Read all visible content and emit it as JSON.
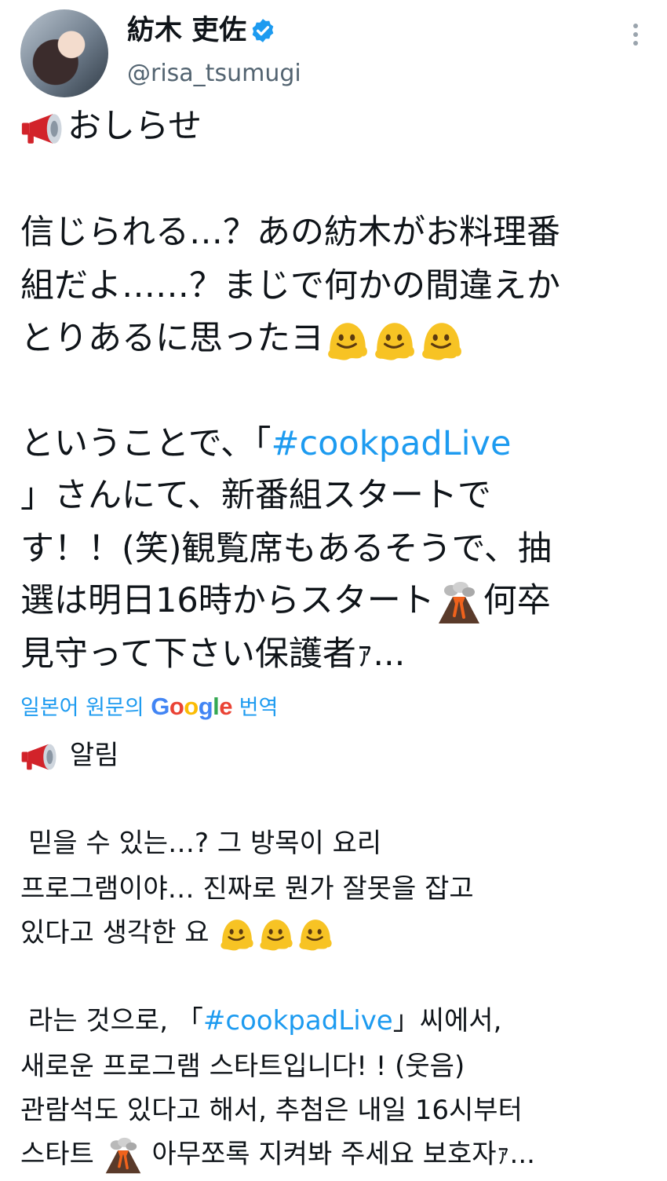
{
  "user": {
    "display_name": "紡木 吏佐",
    "handle": "@risa_tsumugi"
  },
  "icons": {
    "verified": "verified-badge-icon",
    "more": "more-vertical-icon",
    "megaphone": "megaphone-emoji",
    "melting": "melting-face-emoji",
    "volcano": "volcano-emoji"
  },
  "colors": {
    "link": "#1d9bf0",
    "secondary_text": "#536471"
  },
  "original": {
    "heading": "おしらせ",
    "l1": "信じられる…？あの紡木がお料理番",
    "l2": "組だよ……？まじで何かの間違えか",
    "l3": "とりあるに思ったヨ",
    "l4": "ということで、「",
    "l4_hashtag": "#cookpadLive",
    "l5": "」さんにて、新番組スタートで",
    "l6": "す！！(笑)観覧席もあるそうで、抽",
    "l7": "選は明日16時からスタート",
    "l7_after": "何卒",
    "l8": "見守って下さい保護者ｧ..."
  },
  "translation": {
    "label_before": "일본어 원문의",
    "brand": "Google",
    "label_after": "번역",
    "heading": "알림",
    "l1": "믿을 수 있는…? 그 방목이 요리",
    "l2": "프로그램이야… 진짜로 뭔가 잘못을 잡고",
    "l3": "있다고 생각한 요",
    "l4_before": "라는 것으로, 「",
    "l4_hashtag": "#cookpadLive",
    "l4_after": "」씨에서,",
    "l5": "새로운 프로그램 스타트입니다! ! (웃음)",
    "l6": "관람석도 있다고 해서, 추첨은 내일 16시부터",
    "l7_before": "스타트",
    "l7_after": "아무쪼록 지켜봐 주세요 보호자ｧ..."
  }
}
